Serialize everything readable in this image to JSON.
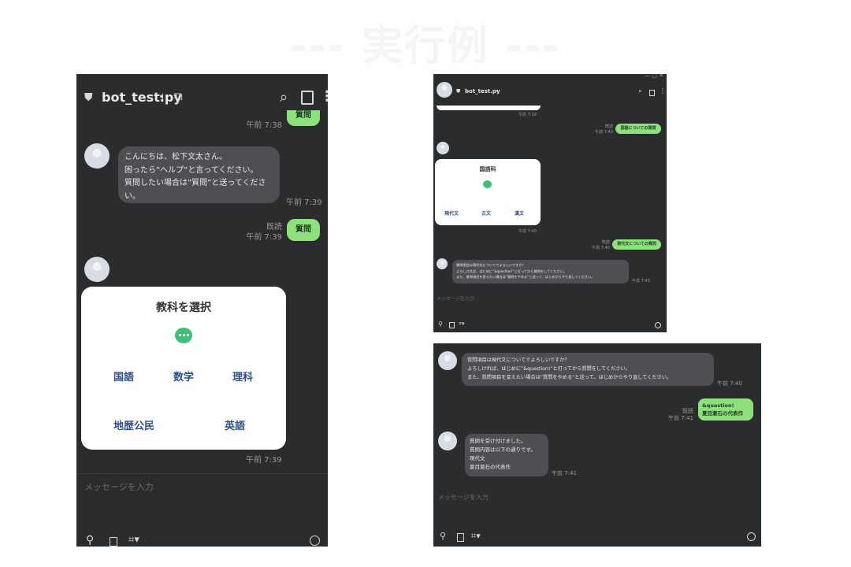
{
  "slide_title": "--- 実行例 ---",
  "panel1": {
    "chat_title": "bot_test.py",
    "top_time": "午前 7:38",
    "top_bubble": "質問",
    "greeting_lines": [
      "こんにちは、松下文太さん。",
      "困ったら”ヘルプ”と言ってください。",
      "質問したい場合は”質問”と送ってくださ",
      "い。"
    ],
    "greeting_time": "午前 7:39",
    "read_label": "既読",
    "question_time": "午前 7:39",
    "question_bubble": "質問",
    "card_title": "教科を選択",
    "subjects": [
      "国語",
      "数学",
      "理科",
      "地歴公民",
      "英語"
    ],
    "card_time": "午前 7:39",
    "input_placeholder": "メッセージを入力"
  },
  "panel2": {
    "chat_title": "bot_test.py",
    "top_time": "午前 7:39",
    "read_label": "既読",
    "msg1_time": "午前 7:40",
    "msg1_bubble": "国語についての質問",
    "card_title": "国語科",
    "options": [
      "現代文",
      "古文",
      "漢文"
    ],
    "card_time": "午前 7:40",
    "msg2_time": "午前 7:40",
    "msg2_bubble": "現代文についての質問",
    "reply_lines": [
      "質問項目は現代文についてでよろしいですか？",
      "よろしければ、はじめに”&question!”と打ってから質問をしてください。",
      "また、質問項目を変えたい場合は”質問をやめる”と送って、はじめからやり直してください。"
    ],
    "reply_time": "午前 7:40",
    "input_placeholder": "メッセージを入力"
  },
  "panel3": {
    "reply_lines": [
      "質問項目は現代文についてでよろしいですか？",
      "よろしければ、はじめに”&question!”と打ってから質問をしてください。",
      "また、質問項目を変えたい場合は”質問をやめる”と送って、はじめからやり直してください。"
    ],
    "reply_time": "午前 7:40",
    "read_label": "既読",
    "user_time": "午前 7:41",
    "user_lines": [
      "&question!",
      "夏目漱石の代表作"
    ],
    "ack_lines": [
      "質問を受け付けました。",
      "質問内容は以下の通りです。",
      "現代文",
      "夏目漱石の代表作"
    ],
    "ack_time": "午前 7:41",
    "input_placeholder": "メッセージを入力"
  },
  "colors": {
    "panel_bg": "#2b2c2e",
    "bubble_green": "#8de07c",
    "bubble_dark": "#4d4f52",
    "bot_icon": "#3fbf79",
    "subject_text": "#2f4f88"
  }
}
